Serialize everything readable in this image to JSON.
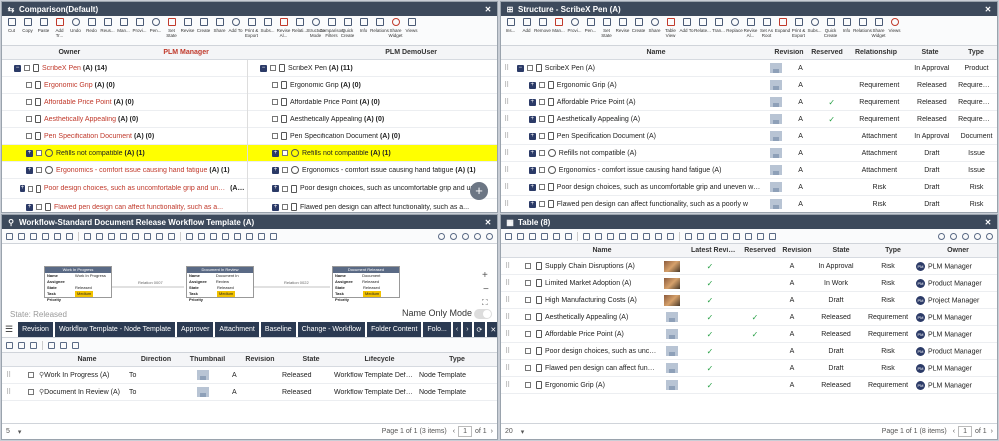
{
  "comparison": {
    "title": "Comparison(Default)",
    "toolbar": [
      "Cut",
      "Copy",
      "Paste",
      "Add Tr...",
      "Undo",
      "Redo",
      "Reus...",
      "Man...",
      "Provi...",
      "Pen...",
      "Set State",
      "Revise",
      "Create",
      "Share",
      "Add To",
      "Print & Export",
      "Subs...",
      "Revise Al...",
      "Relati...",
      "Structure Mode",
      "Comparison Filters",
      "Quick Create",
      "Info",
      "Relations",
      "Share Widget",
      "Views"
    ],
    "col_owner": "Owner",
    "left_owner": "PLM Manager",
    "right_owner": "PLM DemoUser",
    "left_rows": [
      {
        "text": "ScribeX Pen",
        "suffix": "(A) (14)",
        "red": true,
        "icon": "doc"
      },
      {
        "text": "Ergonomic Grip",
        "suffix": "(A) (0)",
        "red": true,
        "icon": "doc"
      },
      {
        "text": "Affordable Price Point",
        "suffix": "(A) (0)",
        "red": true,
        "icon": "doc"
      },
      {
        "text": "Aesthetically Appealing",
        "suffix": "(A) (0)",
        "red": true,
        "icon": "doc"
      },
      {
        "text": "Pen Specification Document",
        "suffix": "(A) (0)",
        "red": true,
        "icon": "doc"
      },
      {
        "text": "Refills not compatible",
        "suffix": "(A) (1)",
        "red": true,
        "icon": "circ",
        "highlight": true
      },
      {
        "text": "Ergonomics - comfort issue causing hand fatigue",
        "suffix": "(A) (1)",
        "red": true,
        "icon": "circ"
      },
      {
        "text": "Poor design choices, such as uncomfortable grip and uneven weight distribution.",
        "suffix": "(A) (1)",
        "red": true,
        "icon": "doc"
      },
      {
        "text": "Flawed pen design can affect functionality, such as a...",
        "suffix": "",
        "red": true,
        "icon": "doc"
      }
    ],
    "right_rows": [
      {
        "text": "ScribeX Pen",
        "suffix": "(A) (11)",
        "icon": "doc"
      },
      {
        "text": "Ergonomic Grip",
        "suffix": "(A) (0)",
        "icon": "doc"
      },
      {
        "text": "Affordable Price Point",
        "suffix": "(A) (0)",
        "icon": "doc"
      },
      {
        "text": "Aesthetically Appealing",
        "suffix": "(A) (0)",
        "icon": "doc"
      },
      {
        "text": "Pen Specification Document",
        "suffix": "(A) (0)",
        "icon": "doc"
      },
      {
        "text": "Refills not compatible",
        "suffix": "(A) (1)",
        "icon": "circ",
        "highlight": true
      },
      {
        "text": "Ergonomics - comfort issue causing hand fatigue",
        "suffix": "(A) (1)",
        "icon": "circ"
      },
      {
        "text": "Poor design choices, such as uncomfortable grip and uneven weight distribution.",
        "suffix": "",
        "icon": "doc"
      },
      {
        "text": "Flawed pen design can affect functionality, such as a...",
        "suffix": "",
        "icon": "doc"
      }
    ]
  },
  "structure": {
    "title": "Structure - ScribeX Pen (A)",
    "toolbar": [
      "Ins...",
      "Add",
      "Remove",
      "Man...",
      "Provi...",
      "Pen...",
      "Set State",
      "Revise",
      "Create",
      "Share",
      "Table View",
      "Add To",
      "Relate...",
      "Tran...",
      "Replace",
      "Revise Al...",
      "Set As Root",
      "Expand",
      "Print & Export",
      "Subs...",
      "Quick Create",
      "Info",
      "Relations",
      "Share Widget",
      "Views"
    ],
    "headers": [
      "Name",
      "Revision",
      "Reserved",
      "Relationship",
      "State",
      "Type"
    ],
    "rows": [
      {
        "name": "ScribeX Pen (A)",
        "rev": "A",
        "reserved": false,
        "rel": "",
        "state": "In Approval",
        "type": "Product",
        "icon": "doc",
        "level": 0
      },
      {
        "name": "Ergonomic Grip (A)",
        "rev": "A",
        "reserved": false,
        "rel": "Requirement",
        "state": "Released",
        "type": "Requirement",
        "icon": "doc",
        "level": 1
      },
      {
        "name": "Affordable Price Point (A)",
        "rev": "A",
        "reserved": true,
        "rel": "Requirement",
        "state": "Released",
        "type": "Requirement",
        "icon": "doc",
        "level": 1
      },
      {
        "name": "Aesthetically Appealing (A)",
        "rev": "A",
        "reserved": true,
        "rel": "Requirement",
        "state": "Released",
        "type": "Requirement",
        "icon": "doc",
        "level": 1
      },
      {
        "name": "Pen Specification Document (A)",
        "rev": "A",
        "reserved": false,
        "rel": "Attachment",
        "state": "In Approval",
        "type": "Document",
        "icon": "doc",
        "level": 1
      },
      {
        "name": "Refills not compatible (A)",
        "rev": "A",
        "reserved": false,
        "rel": "Attachment",
        "state": "Draft",
        "type": "Issue",
        "icon": "circ",
        "level": 1
      },
      {
        "name": "Ergonomics - comfort issue causing hand fatigue (A)",
        "rev": "A",
        "reserved": false,
        "rel": "Attachment",
        "state": "Draft",
        "type": "Issue",
        "icon": "circ",
        "level": 1
      },
      {
        "name": "Poor design choices, such as uncomfortable grip and uneven weight",
        "rev": "A",
        "reserved": false,
        "rel": "Risk",
        "state": "Draft",
        "type": "Risk",
        "icon": "doc",
        "level": 1
      },
      {
        "name": "Flawed pen design can affect functionality, such as a poorly w",
        "rev": "A",
        "reserved": false,
        "rel": "Risk",
        "state": "Draft",
        "type": "Risk",
        "icon": "doc",
        "level": 1
      }
    ]
  },
  "workflow": {
    "title": "Workflow-Standard Document Release Workflow Template (A)",
    "state_label": "State: Released",
    "name_only_mode": "Name Only Mode",
    "nodes": [
      {
        "title": "Work In Progress",
        "name": "Work In Progress",
        "assignee": "",
        "state": "Released",
        "priority": "Medium"
      },
      {
        "title": "Document In Review",
        "name": "Document In Review",
        "assignee": "",
        "state": "Released",
        "priority": "Medium"
      },
      {
        "title": "Document Released",
        "name": "Document Released",
        "assignee": "",
        "state": "Released",
        "priority": "Medium"
      }
    ],
    "node_fields": {
      "name": "Name",
      "assignee": "Assignee",
      "state": "State",
      "priority": "Task Priority"
    },
    "edges": [
      "Relation 0007",
      "Relation 0022"
    ],
    "tabs": [
      "Revision",
      "Workflow Template - Node Template",
      "Approver",
      "Attachment",
      "Baseline",
      "Change - Workflow",
      "Folder Content",
      "Folo..."
    ],
    "headers": [
      "Name",
      "Direction",
      "Thumbnail",
      "Revision",
      "State",
      "Lifecycle",
      "Type"
    ],
    "rows": [
      {
        "name": "Work In Progress (A)",
        "direction": "To",
        "rev": "A",
        "state": "Released",
        "lifecycle": "Workflow Template Default",
        "type": "Node Template"
      },
      {
        "name": "Document In Review (A)",
        "direction": "To",
        "rev": "A",
        "state": "Released",
        "lifecycle": "Workflow Template Default",
        "type": "Node Template"
      }
    ],
    "page_size": "5",
    "page_info": "Page 1 of 1 (3 items)",
    "page": "1",
    "of": "of 1"
  },
  "table": {
    "title": "Table (8)",
    "headers": [
      "Name",
      "Latest Revisi...",
      "Reserved",
      "Revision",
      "State",
      "Type",
      "Owner"
    ],
    "rows": [
      {
        "name": "Supply Chain Disruptions (A)",
        "latest": true,
        "reserved": false,
        "rev": "A",
        "state": "In Approval",
        "type": "Risk",
        "owner": "PLM Manager"
      },
      {
        "name": "Limited Market Adoption (A)",
        "latest": true,
        "reserved": false,
        "rev": "A",
        "state": "In Work",
        "type": "Risk",
        "owner": "Product Manager"
      },
      {
        "name": "High Manufacturing Costs (A)",
        "latest": true,
        "reserved": false,
        "rev": "A",
        "state": "Draft",
        "type": "Risk",
        "owner": "Project Manager"
      },
      {
        "name": "Aesthetically Appealing (A)",
        "latest": true,
        "reserved": true,
        "rev": "A",
        "state": "Released",
        "type": "Requirement",
        "owner": "PLM Manager"
      },
      {
        "name": "Affordable Price Point (A)",
        "latest": true,
        "reserved": true,
        "rev": "A",
        "state": "Released",
        "type": "Requirement",
        "owner": "PLM Manager"
      },
      {
        "name": "Poor design choices, such as uncomfor",
        "latest": true,
        "reserved": false,
        "rev": "A",
        "state": "Draft",
        "type": "Risk",
        "owner": "Product Manager"
      },
      {
        "name": "Flawed pen design can affect functionali",
        "latest": true,
        "reserved": false,
        "rev": "A",
        "state": "Draft",
        "type": "Risk",
        "owner": "PLM Manager"
      },
      {
        "name": "Ergonomic Grip (A)",
        "latest": true,
        "reserved": false,
        "rev": "A",
        "state": "Released",
        "type": "Requirement",
        "owner": "PLM Manager"
      }
    ],
    "page_size": "20",
    "page_info": "Page 1 of 1 (8 items)",
    "page": "1",
    "of": "of 1"
  },
  "owner_initials": "PM"
}
